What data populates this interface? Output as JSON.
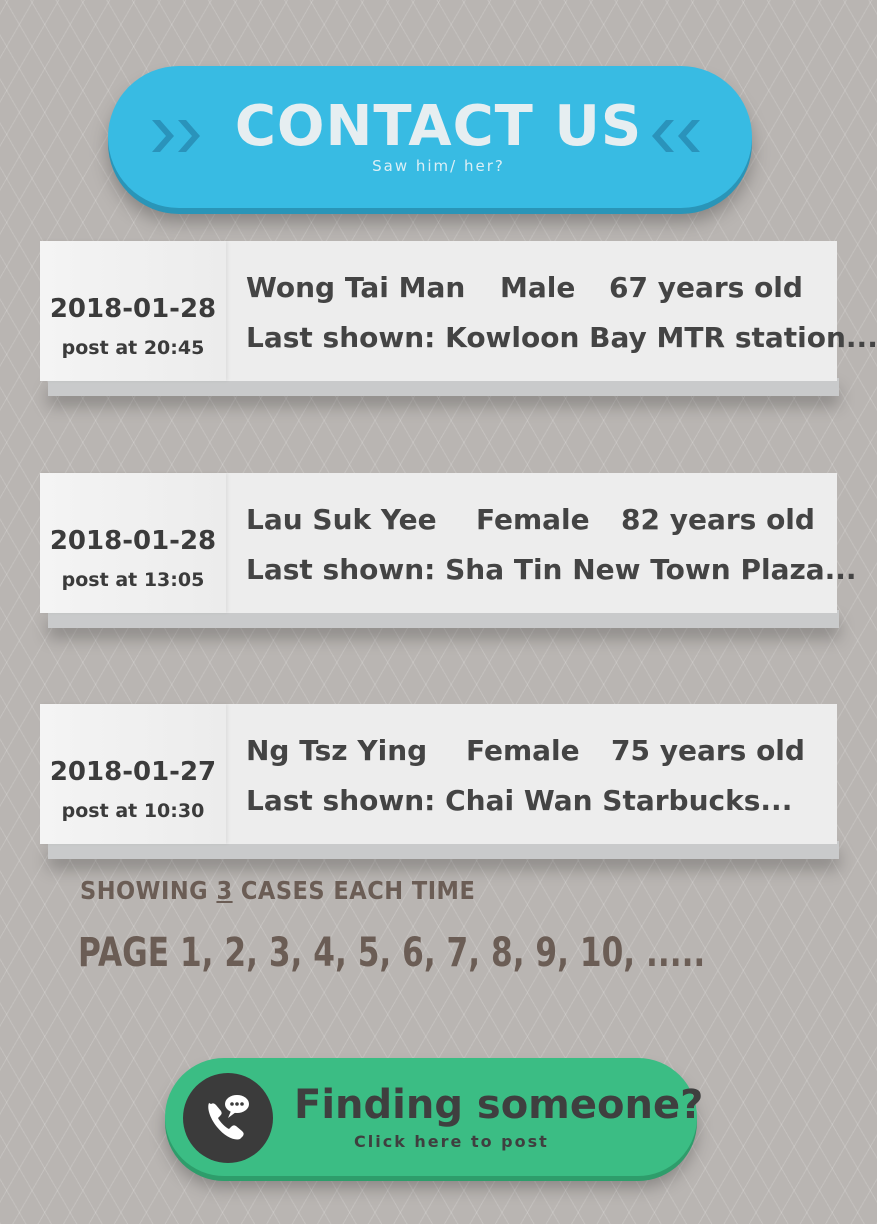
{
  "contact": {
    "title": "CONTACT US",
    "subtitle": "Saw him/ her?"
  },
  "cases": [
    {
      "date": "2018-01-28",
      "time": "post at 20:45",
      "name": "Wong Tai Man",
      "gender": "Male",
      "age": "67 years old",
      "last_shown": "Last shown: Kowloon Bay MTR station..."
    },
    {
      "date": "2018-01-28",
      "time": "post at 13:05",
      "name": "Lau Suk Yee",
      "gender": "Female",
      "age": "82 years old",
      "last_shown": "Last shown: Sha Tin New Town Plaza..."
    },
    {
      "date": "2018-01-27",
      "time": "post at 10:30",
      "name": "Ng Tsz Ying",
      "gender": "Female",
      "age": "75 years old",
      "last_shown": "Last shown: Chai Wan Starbucks..."
    }
  ],
  "paging": {
    "showing_prefix": "Showing",
    "per_page": "3",
    "showing_suffix": "cases each time",
    "page_label": "PAGE",
    "pages": [
      "1",
      "2",
      "3",
      "4",
      "5",
      "6",
      "7",
      "8",
      "9",
      "10"
    ],
    "more": "....."
  },
  "post": {
    "title": "Finding someone?",
    "subtitle": "Click here to post"
  },
  "colors": {
    "contact_button": "#38bbe3",
    "post_button": "#3bbd84",
    "background": "#b9b5b2"
  },
  "icons": {
    "contact_left": "double-chevron-right-icon",
    "contact_right": "double-chevron-left-icon",
    "post": "phone-chat-icon"
  }
}
